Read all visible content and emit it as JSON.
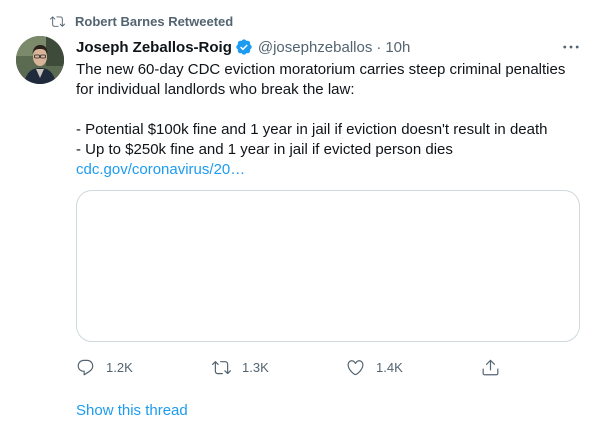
{
  "retweet_banner": {
    "text": "Robert Barnes Retweeted",
    "icon": "retweet-icon"
  },
  "author": {
    "display_name": "Joseph Zeballos-Roig",
    "handle": "@josephzeballos",
    "separator": "·",
    "time": "10h",
    "verified": true
  },
  "tweet": {
    "lines": [
      "The new 60-day CDC eviction moratorium carries steep criminal penalties",
      "for individual landlords who break the law:",
      "",
      "- Potential $100k fine and 1 year in jail if eviction doesn't result in death",
      "- Up to $250k fine and 1 year in jail if evicted person dies"
    ],
    "link": "cdc.gov/coronavirus/20…"
  },
  "actions": {
    "reply_count": "1.2K",
    "retweet_count": "1.3K",
    "like_count": "1.4K"
  },
  "show_thread": "Show this thread",
  "colors": {
    "accent": "#1d9bf0",
    "muted": "#536471",
    "text": "#0f1419",
    "border": "#cfd9de"
  }
}
